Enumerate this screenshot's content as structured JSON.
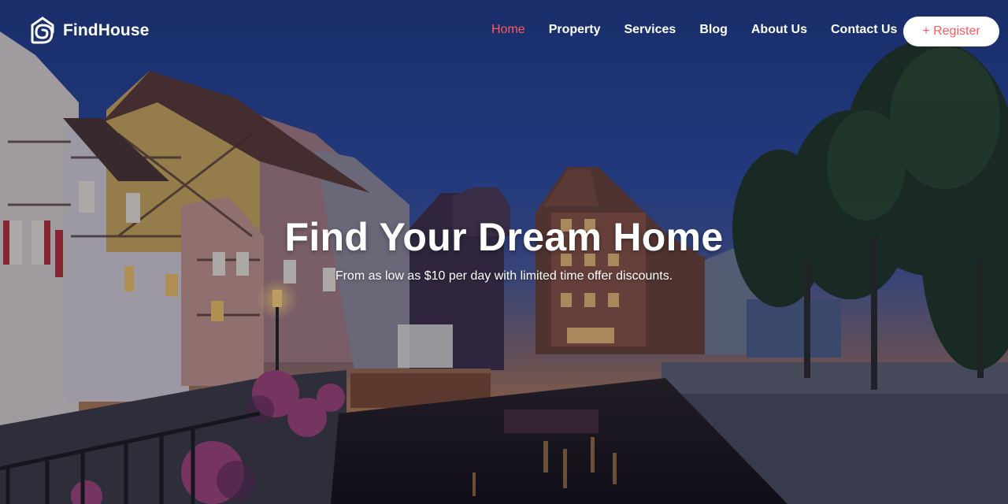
{
  "brand": {
    "name": "FindHouse",
    "logo_icon": "house-pin-icon",
    "accent_color": "#ff5a5f"
  },
  "nav": {
    "items": [
      {
        "label": "Home",
        "active": true
      },
      {
        "label": "Property",
        "active": false
      },
      {
        "label": "Services",
        "active": false
      },
      {
        "label": "Blog",
        "active": false
      },
      {
        "label": "About Us",
        "active": false
      },
      {
        "label": "Contact Us",
        "active": false
      }
    ],
    "register_label": "+ Register"
  },
  "hero": {
    "title": "Find Your Dream Home",
    "subtitle": "From as low as $10 per day with limited time offer discounts.",
    "background": "evening canal with half-timbered houses"
  }
}
